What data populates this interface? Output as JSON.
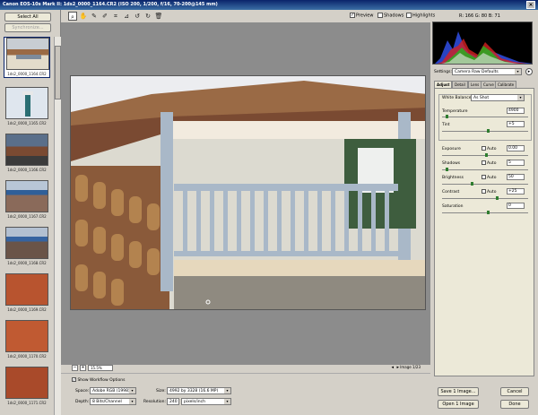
{
  "window": {
    "title": "Canon EOS-10s Mark II: 1ds2_0000_1164.CR2 (ISO 200, 1/200, f/16, 70-200@145 mm)"
  },
  "filmstrip": {
    "select_all_label": "Select All",
    "synchronize_label": "Synchronize...",
    "thumbs": [
      {
        "label": "1ds2_0000_1164.CR2",
        "selected": true
      },
      {
        "label": "1ds2_0000_1165.CR2",
        "selected": false
      },
      {
        "label": "1ds2_0000_1166.CR2",
        "selected": false
      },
      {
        "label": "1ds2_0000_1167.CR2",
        "selected": false
      },
      {
        "label": "1ds2_0000_1168.CR2",
        "selected": false
      },
      {
        "label": "1ds2_0000_1169.CR2",
        "selected": false
      },
      {
        "label": "1ds2_0000_1170.CR2",
        "selected": false
      },
      {
        "label": "1ds2_0000_1171.CR2",
        "selected": false
      }
    ],
    "rating_marks": "• • • • •"
  },
  "toolbar": {
    "preview_label": "Preview",
    "shadows_label": "Shadows",
    "highlights_label": "Highlights",
    "rgb_readout": "R: 166   G: 80   B: 71"
  },
  "preview": {
    "zoom_value": "15.5%",
    "image_count": "Image 1/23"
  },
  "workflow": {
    "show_options_label": "Show Workflow Options",
    "space_label": "Space:",
    "space_value": "Adobe RGB (1998)",
    "size_label": "Size:",
    "size_value": "4992 by 3328 (16.6 MP)",
    "depth_label": "Depth:",
    "depth_value": "8 Bits/Channel",
    "resolution_label": "Resolution:",
    "resolution_value": "240",
    "resolution_unit": "pixels/inch"
  },
  "settings": {
    "label": "Settings:",
    "value": "Camera Raw Defaults"
  },
  "tabs": [
    "Adjust",
    "Detail",
    "Lens",
    "Curve",
    "Calibrate"
  ],
  "adjust": {
    "white_balance_label": "White Balance:",
    "white_balance_value": "As Shot",
    "temperature_label": "Temperature",
    "temperature_value": "4900",
    "tint_label": "Tint",
    "tint_value": "+5",
    "exposure_label": "Exposure",
    "exposure_value": "0.00",
    "shadows_label": "Shadows",
    "shadows_value": "5",
    "brightness_label": "Brightness",
    "brightness_value": "50",
    "contrast_label": "Contrast",
    "contrast_value": "+25",
    "saturation_label": "Saturation",
    "saturation_value": "0",
    "auto_label": "Auto"
  },
  "buttons": {
    "save_label": "Save 1 Image...",
    "open_label": "Open 1 Image",
    "cancel_label": "Cancel",
    "done_label": "Done"
  },
  "colors": {
    "titlebar": "#0a246a",
    "slider_knob": "#2f7d2f"
  }
}
